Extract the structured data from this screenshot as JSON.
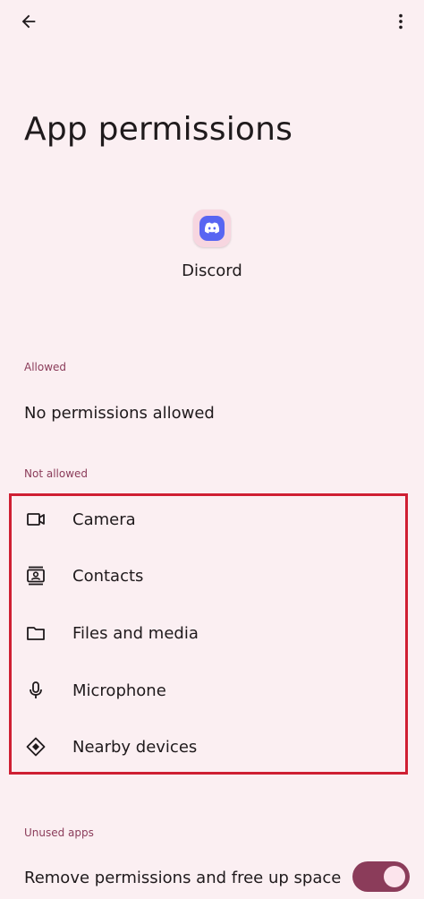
{
  "header": {
    "back_icon": "arrow-left-icon",
    "more_icon": "more-vert-icon"
  },
  "page": {
    "title": "App permissions"
  },
  "app": {
    "name": "Discord",
    "icon": "discord-icon",
    "icon_bg": "#f7d6e0",
    "brand_color": "#5865f2"
  },
  "sections": {
    "allowed": {
      "label": "Allowed",
      "empty_text": "No permissions allowed"
    },
    "not_allowed": {
      "label": "Not allowed",
      "items": [
        {
          "label": "Camera",
          "icon": "camera-icon"
        },
        {
          "label": "Contacts",
          "icon": "contacts-icon"
        },
        {
          "label": "Files and media",
          "icon": "folder-icon"
        },
        {
          "label": "Microphone",
          "icon": "microphone-icon"
        },
        {
          "label": "Nearby devices",
          "icon": "nearby-devices-icon"
        }
      ]
    },
    "unused_apps": {
      "label": "Unused apps",
      "toggle_label": "Remove permissions and free up space",
      "toggle_on": true
    }
  },
  "colors": {
    "background": "#fbeff2",
    "accent": "#8b3c5a",
    "highlight": "#cf1f33",
    "text": "#1f1a1c"
  }
}
